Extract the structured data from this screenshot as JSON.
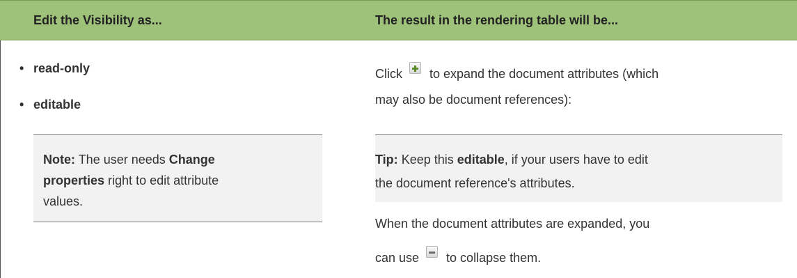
{
  "header": {
    "col1": "Edit the Visibility as...",
    "col2": "The result in the rendering table will be..."
  },
  "left": {
    "bullets": [
      "read-only",
      "editable"
    ],
    "bullet_glyph": "•",
    "note": {
      "label": "Note:",
      "part1": "The user needs",
      "bold": "Change properties",
      "part2": "right to edit attribute values.",
      "line1_end": "Change",
      "line2_bold": "properties",
      "line2_rest": "right to edit attribute",
      "line3": "values."
    }
  },
  "right": {
    "line1_pre": "Click",
    "line1_post": "to expand the document attributes (which",
    "line2": "may also be document references):",
    "tip": {
      "label": "Tip:",
      "pre": "Keep this",
      "bold": "editable",
      "post": ", if your users have to edit",
      "line2": "the document reference's attributes."
    },
    "line3": "When the document attributes are expanded, you",
    "line4_pre": "can use",
    "line4_post": "to collapse them."
  },
  "icons": {
    "expand": "plus-icon",
    "collapse": "minus-icon"
  },
  "colors": {
    "header_bg": "#9ec27a",
    "box_bg": "#f2f2f2",
    "text": "#333333"
  }
}
